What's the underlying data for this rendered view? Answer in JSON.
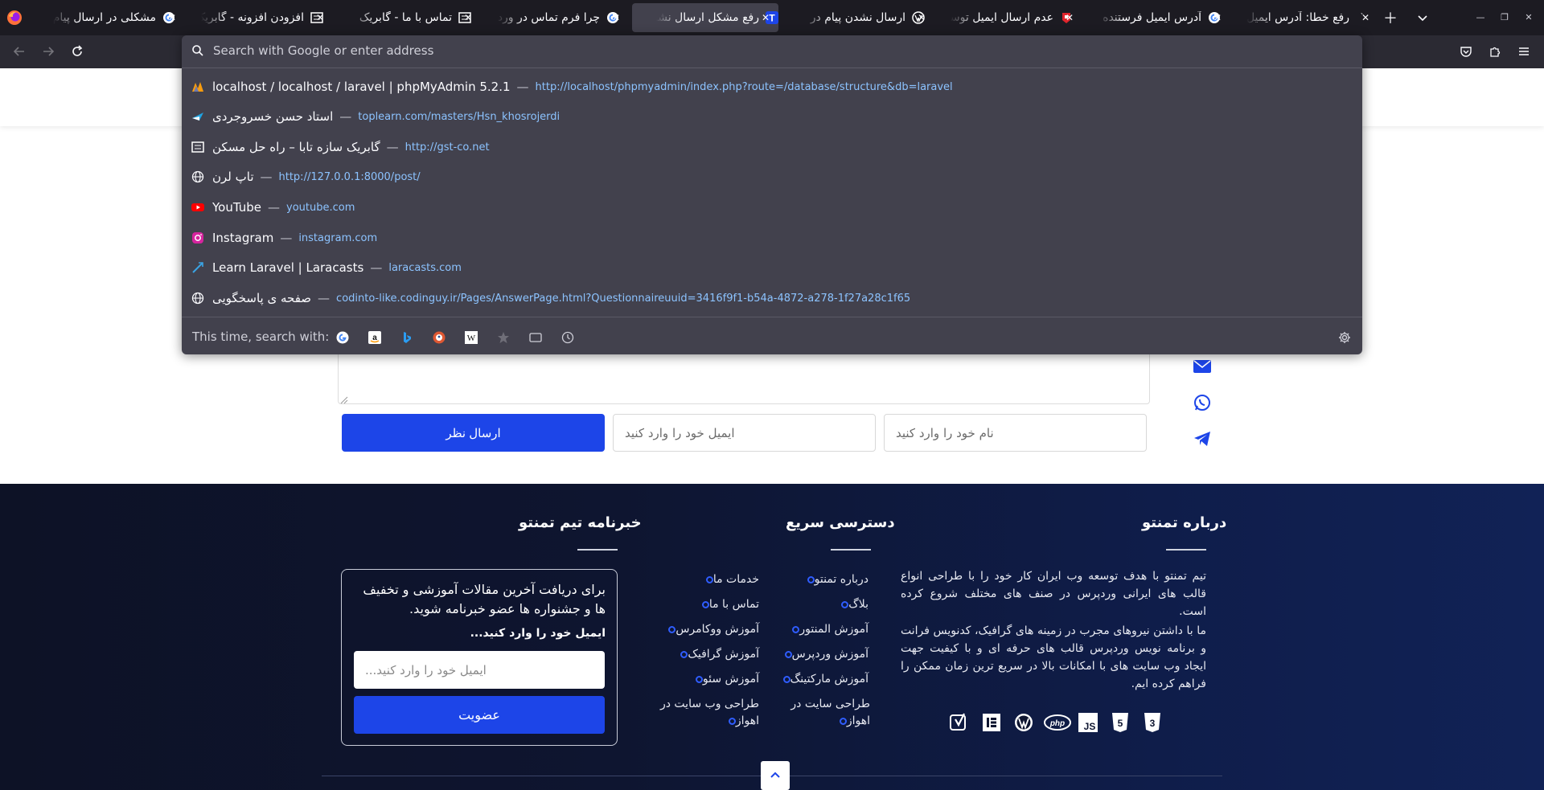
{
  "browser": {
    "tabs": [
      {
        "title": "مشکلی در ارسال پیام",
        "favicon": "google-icon"
      },
      {
        "title": "افزودن افزونه - گابریک",
        "favicon": "gst-icon"
      },
      {
        "title": "تماس با ما - گابریک",
        "favicon": "gst-icon"
      },
      {
        "title": "چرا فرم تماس در ورد",
        "favicon": "google-icon"
      },
      {
        "title": "رفع مشکل ارسال نشدن",
        "favicon": "tamento-icon",
        "active": true
      },
      {
        "title": "ارسال نشدن پیام در",
        "favicon": "wordpress-icon"
      },
      {
        "title": "عدم ارسال ایمیل توسط",
        "favicon": "red-icon"
      },
      {
        "title": "آدرس ایمیل فرستنده",
        "favicon": "google-icon"
      },
      {
        "title": "رفع خطا: آدرس ایمیل",
        "favicon": "blank-icon"
      }
    ],
    "urlbar": {
      "placeholder": "Search with Google or enter address",
      "results": [
        {
          "title": "localhost / localhost / laravel | phpMyAdmin 5.2.1",
          "url": "http://localhost/phpmyadmin/index.php?route=/database/structure&db=laravel",
          "icon": "phpmyadmin-icon"
        },
        {
          "title": "استاد حسن خسروجردی",
          "url": "toplearn.com/masters/Hsn_khosrojerdi",
          "icon": "toplearn-icon"
        },
        {
          "title": "گابریک سازه تابا – راه حل مسکن",
          "url": "http://gst-co.net",
          "icon": "gst-icon"
        },
        {
          "title": "تاپ لرن",
          "url": "http://127.0.0.1:8000/post/",
          "icon": "globe-icon"
        },
        {
          "title": "YouTube",
          "url": "youtube.com",
          "icon": "youtube-icon"
        },
        {
          "title": "Instagram",
          "url": "instagram.com",
          "icon": "instagram-icon"
        },
        {
          "title": "Learn Laravel | Laracasts",
          "url": "laracasts.com",
          "icon": "laracasts-icon"
        },
        {
          "title": "صفحه ی پاسخگویی",
          "url": "codinto-like.codinguy.ir/Pages/AnswerPage.html?Questionnaireuuid=3416f9f1-b54a-4872-a278-1f27a28c1f65",
          "icon": "globe-icon"
        }
      ],
      "oneoff_label": "This time, search with:",
      "oneoff_engines": [
        "google-icon",
        "amazon-icon",
        "bing-icon",
        "duckduckgo-icon",
        "wikipedia-icon",
        "bookmarks-icon",
        "tabs-icon",
        "history-icon"
      ]
    }
  },
  "form": {
    "submit_label": "ارسال نظر",
    "email_placeholder": "ایمیل خود را وارد کنید",
    "name_placeholder": "نام خود را وارد کنید",
    "social_icons": [
      "email-icon",
      "whatsapp-icon",
      "telegram-icon"
    ]
  },
  "footer": {
    "about": {
      "title": "درباره تمنتو",
      "paragraph1": "تیم تمنتو با هدف توسعه وب ایران کار خود را با طراحی انواع قالب های ایرانی وردپرس در صنف های مختلف شروع کرده است.",
      "paragraph2": "ما با داشتن نیروهای مجرب در زمینه های گرافیک، کدنویس فرانت و برنامه نویس وردپرس قالب های حرفه ای و با کیفیت جهت ایجاد وب سایت های با امکانات بالا در سریع ترین زمان ممکن را فراهم کرده ایم.",
      "tech_icons": [
        "yoast-icon",
        "elementor-icon",
        "wordpress-icon",
        "php-icon",
        "javascript-icon",
        "html5-icon",
        "css3-icon"
      ]
    },
    "quick_access": {
      "title": "دسترسی سریع",
      "col1": [
        "درباره تمنتو",
        "بلاگ",
        "آموزش المنتور",
        "آموزش وردپرس",
        "آموزش مارکتینگ",
        "طراحی سایت در اهواز"
      ],
      "col2": [
        "خدمات ما",
        "تماس با ما",
        "آموزش ووکامرس",
        "آموزش گرافیک",
        "آموزش سئو",
        "طراحی وب سایت در اهواز"
      ]
    },
    "newsletter": {
      "title": "خبرنامه تیم تمنتو",
      "text": "برای دریافت آخرین مقالات آموزشی و تخفیف ها و جشنواره ها عضو خبرنامه شوید.",
      "label": "ایمیل خود را وارد کنید...",
      "placeholder": "ایمیل خود را وارد کنید...",
      "button": "عضویت"
    }
  },
  "colors": {
    "accent": "#1d45e8",
    "footer_bg": "#0e1530",
    "chrome_bg": "#1c1b22",
    "dropdown_bg": "#42414d",
    "link": "#8cc3ff"
  }
}
